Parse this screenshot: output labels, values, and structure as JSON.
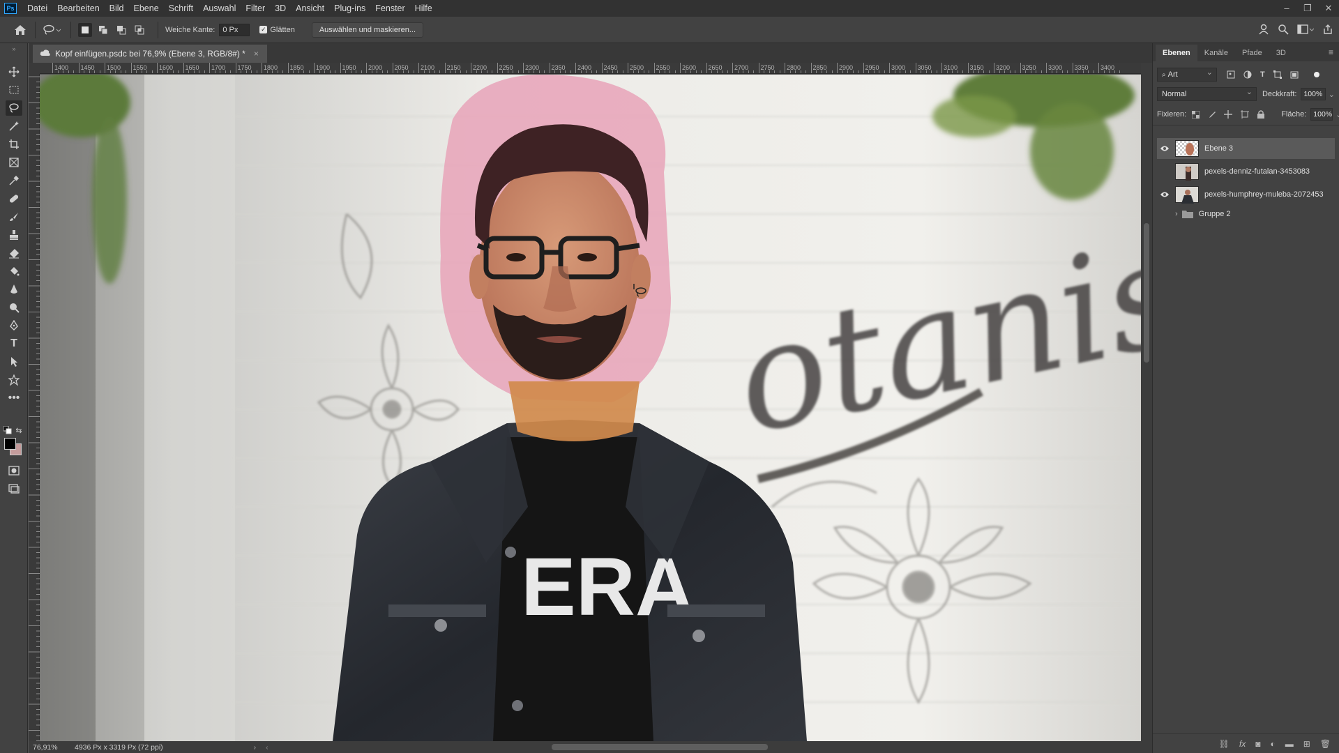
{
  "menubar": {
    "app_icon": "Ps",
    "items": [
      "Datei",
      "Bearbeiten",
      "Bild",
      "Ebene",
      "Schrift",
      "Auswahl",
      "Filter",
      "3D",
      "Ansicht",
      "Plug-ins",
      "Fenster",
      "Hilfe"
    ]
  },
  "options": {
    "feather_label": "Weiche Kante:",
    "feather_value": "0 Px",
    "antialias_label": "Glätten",
    "antialias_checked": true,
    "select_mask_label": "Auswählen und maskieren..."
  },
  "document": {
    "tab_title": "Kopf einfügen.psdc bei 76,9% (Ebene 3, RGB/8#) *",
    "ruler_labels": [
      "1400",
      "1450",
      "1500",
      "1550",
      "1600",
      "1650",
      "1700",
      "1750",
      "1800",
      "1850",
      "1900",
      "1950",
      "2000",
      "2050",
      "2100",
      "2150",
      "2200",
      "2250",
      "2300",
      "2350",
      "2400",
      "2450",
      "2500",
      "2550",
      "2600",
      "2650",
      "2700",
      "2750",
      "2800",
      "2850",
      "2900",
      "2950",
      "3000",
      "3050",
      "3100",
      "3150",
      "3200",
      "3250",
      "3300",
      "3350",
      "3400"
    ],
    "canvas_text": "otanist",
    "shirt_text": "ERA"
  },
  "status": {
    "zoom": "76,91%",
    "dimensions": "4936 Px x 3319 Px (72 ppi)"
  },
  "panel": {
    "tabs": [
      "Ebenen",
      "Kanäle",
      "Pfade",
      "3D"
    ],
    "active_tab": "Ebenen",
    "filter_kind": "Art",
    "blend_mode": "Normal",
    "opacity_label": "Deckkraft:",
    "opacity_value": "100%",
    "lock_label": "Fixieren:",
    "fill_label": "Fläche:",
    "fill_value": "100%",
    "layers": [
      {
        "name": "Ebene 3",
        "visible": true,
        "selected": true
      },
      {
        "name": "pexels-denniz-futalan-3453083",
        "visible": false,
        "selected": false
      },
      {
        "name": "pexels-humphrey-muleba-2072453",
        "visible": true,
        "selected": false
      },
      {
        "name": "Gruppe 2",
        "visible": false,
        "selected": false
      }
    ]
  },
  "colors": {
    "accent": "#31a8ff",
    "selection_overlay": "#e8a3b8",
    "foreground": "#000000",
    "background": "#c49c9c"
  }
}
